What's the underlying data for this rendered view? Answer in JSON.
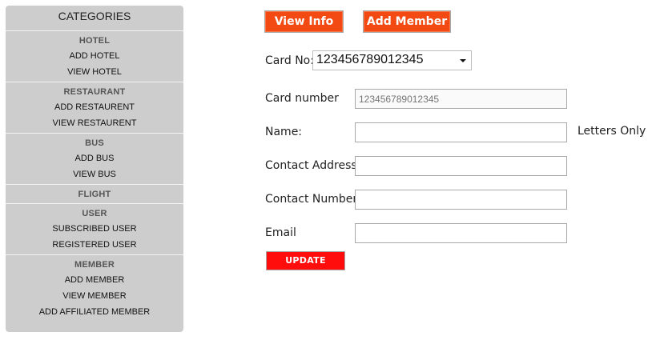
{
  "sidebar": {
    "title": "CATEGORIES",
    "categories": [
      {
        "title": "HOTEL",
        "items": [
          "ADD HOTEL",
          "VIEW HOTEL"
        ]
      },
      {
        "title": "RESTAURANT",
        "items": [
          "ADD RESTAURENT",
          "VIEW RESTAURENT"
        ]
      },
      {
        "title": "BUS",
        "items": [
          "ADD BUS",
          "VIEW BUS"
        ]
      },
      {
        "title": "FLIGHT",
        "items": []
      },
      {
        "title": "USER",
        "items": [
          "SUBSCRIBED USER",
          "REGISTERED USER"
        ]
      },
      {
        "title": "MEMBER",
        "items": [
          "ADD MEMBER",
          "VIEW MEMBER",
          "ADD AFFILIATED MEMBER"
        ]
      }
    ]
  },
  "toolbar": {
    "view_info_label": "View Info",
    "add_member_label": "Add Member"
  },
  "form": {
    "card_no_label": "Card No:",
    "card_no_selected": "123456789012345",
    "card_number_label": "Card number",
    "card_number_placeholder": "123456789012345",
    "name_label": "Name:",
    "name_hint": "Letters Only",
    "contact_address_label": "Contact Address",
    "contact_number_label": "Contact Number",
    "email_label": "Email",
    "update_label": "UPDATE"
  },
  "colors": {
    "tab_button": "#f24a12",
    "update_button": "#ff0d0d",
    "sidebar_bg": "#cdcdcd"
  }
}
